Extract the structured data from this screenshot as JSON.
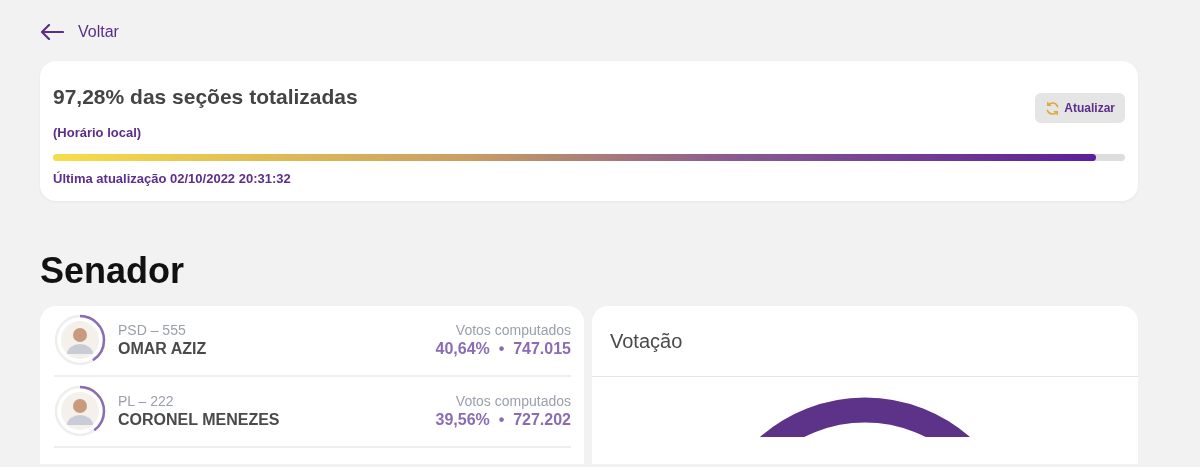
{
  "back_link": {
    "label": "Voltar"
  },
  "progress_card": {
    "title": "97,28% das seções totalizadas",
    "subtitle": "(Horário local)",
    "refresh_button": "Atualizar",
    "level": 0.9728,
    "last_update": "Última atualização 02/10/2022 20:31:32"
  },
  "section_title": "Senador",
  "candidates": [
    {
      "party": "PSD – 555",
      "name": "OMAR AZIZ",
      "votes_label": "Votos computados",
      "percent": "40,64%",
      "separator": "•",
      "votes": "747.015",
      "level": 0.4064
    },
    {
      "party": "PL – 222",
      "name": "CORONEL MENEZES",
      "votes_label": "Votos computados",
      "percent": "39,56%",
      "separator": "•",
      "votes": "727.202",
      "level": 0.3956
    }
  ],
  "chart_panel": {
    "title": "Votação"
  }
}
